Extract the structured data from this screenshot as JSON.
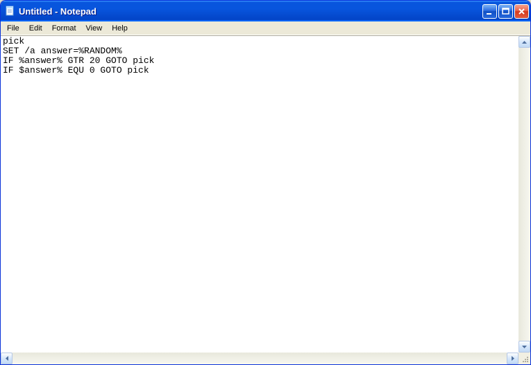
{
  "window": {
    "title": "Untitled - Notepad"
  },
  "menu": {
    "file": "File",
    "edit": "Edit",
    "format": "Format",
    "view": "View",
    "help": "Help"
  },
  "editor": {
    "content": "pick\nSET /a answer=%RANDOM%\nIF %answer% GTR 20 GOTO pick\nIF $answer% EQU 0 GOTO pick"
  }
}
